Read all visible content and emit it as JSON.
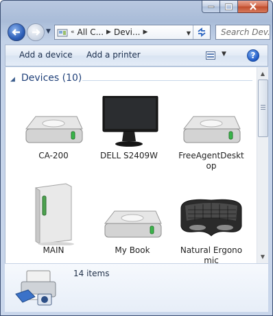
{
  "toolbar": {
    "breadcrumb": [
      "All C...",
      "Devi..."
    ],
    "search_placeholder": "Search Dev..."
  },
  "commands": {
    "add_device": "Add a device",
    "add_printer": "Add a printer",
    "help": "?"
  },
  "group": {
    "title": "Devices (10)"
  },
  "devices": [
    {
      "label": "CA-200",
      "icon": "drive-icon"
    },
    {
      "label": "DELL S2409W",
      "icon": "monitor-icon"
    },
    {
      "label": "FreeAgentDesktop",
      "icon": "drive-icon"
    },
    {
      "label": "MAIN",
      "icon": "tower-pc-icon"
    },
    {
      "label": "My Book",
      "icon": "drive-icon"
    },
    {
      "label": "Natural Ergonomic",
      "icon": "keyboard-icon"
    }
  ],
  "details": {
    "count": "14 items"
  },
  "colors": {
    "accent": "#1e3f78",
    "window_frame": "#b9c8e0"
  }
}
